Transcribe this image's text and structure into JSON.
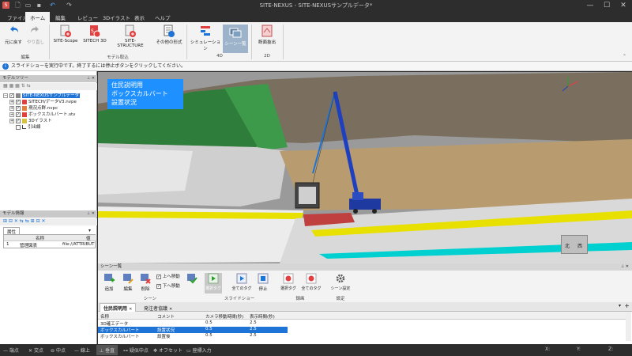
{
  "window": {
    "title": "SITE-NEXUS - SITE-NEXUSサンプルデータ*",
    "min": "—",
    "max": "☐",
    "close": "✕"
  },
  "menu": {
    "tabs": [
      "ファイル",
      "ホーム",
      "編集",
      "レビュー",
      "3Dイラスト",
      "表示",
      "ヘルプ"
    ]
  },
  "ribbon": {
    "undo": "元に戻す",
    "redo": "やり直し",
    "edit_group": "編集",
    "sitescope": "SITE-Scope",
    "sitech3d": "SITECH 3D",
    "sitestructure": "SITE-STRUCTURE",
    "other": "その他の形式",
    "import_group": "モデル取込",
    "simulation": "シミュレーション",
    "scenes": "シーン一覧",
    "group4d": "4D",
    "section": "断面抜出",
    "group2d": "2D"
  },
  "info": {
    "message": "スライドショーを実行中です。終了するには停止ボタンをクリックしてください。"
  },
  "left": {
    "tree_title": "モデルツリー",
    "tree": [
      {
        "label": "SITE-NEXUSサンプルデータ",
        "selected": true
      },
      {
        "label": "SITECH/データV3.nvpe",
        "selected": false
      },
      {
        "label": "現況点群.nvpc",
        "selected": false
      },
      {
        "label": "ボックスカルバート.stv",
        "selected": false
      },
      {
        "label": "3Dイラスト",
        "selected": false
      },
      {
        "label": "引出線",
        "selected": false
      }
    ],
    "info_title": "モデル情報",
    "attr_tab": "属性",
    "col_name": "名称",
    "col_value": "値",
    "row_index": "1",
    "row_name": "管理図表",
    "row_value": "file://ATTRIBUT"
  },
  "viewport": {
    "caption": [
      "住民説明用",
      "ボックスカルバート",
      "設置状況"
    ],
    "compass_n": "北",
    "compass_w": "西"
  },
  "scene": {
    "title": "シーン一覧",
    "add": "追加",
    "edit": "編集",
    "delete": "削除",
    "move_up": "上へ移動",
    "move_down": "下へ移動",
    "scene_group": "シーン",
    "play_selected": "選択タグ",
    "play_all": "全てのタグ",
    "stop": "停止",
    "slideshow_group": "スライドショー",
    "rec_selected": "選択タグ",
    "rec_all": "全てのタグ",
    "record_group": "録画",
    "settings": "シーン設定",
    "settings_group": "設定",
    "tabs": [
      "住民説明用",
      "発注者協議"
    ],
    "columns": [
      "名称",
      "コメント",
      "カメラ移動時間(秒)",
      "表示時間(秒)"
    ],
    "rows": [
      [
        "3D確工データ",
        "",
        "0.5",
        "2.5"
      ],
      [
        "ボックスカルバート",
        "設置状況",
        "0.5",
        "2.5"
      ],
      [
        "ボックスカルバート",
        "設置後",
        "0.5",
        "2.5"
      ]
    ],
    "selected_row": 1
  },
  "status": {
    "items": [
      "端点",
      "交点",
      "中点",
      "線上",
      "垂直",
      "疑似中点",
      "オフセット",
      "座標入力"
    ],
    "x_label": "X:",
    "y_label": "Y:",
    "z_label": "Z:"
  },
  "colors": {
    "accent": "#1e73d6",
    "selection": "#3a78d4",
    "dark": "#2d2d2d"
  }
}
